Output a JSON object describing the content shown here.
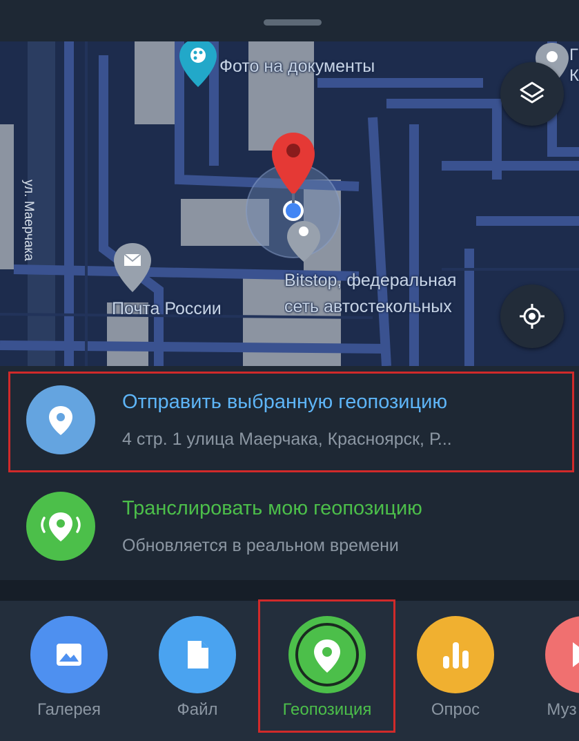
{
  "map": {
    "labels": {
      "photo_docs": "Фото на документы",
      "post_office": "Почта России",
      "bitstop_line1": "Bitstop, федеральная",
      "bitstop_line2": "сеть автостекольных",
      "street": "ул. Маерчака",
      "edge_label_top": "Г",
      "edge_label_bottom": "К"
    },
    "icons": [
      "palette-icon",
      "mail-icon",
      "layers-icon",
      "my-location-icon",
      "red-pin-icon",
      "current-location-icon"
    ]
  },
  "send_location": {
    "title": "Отправить выбранную геопозицию",
    "address": "4 стр. 1 улица Маерчака, Красноярск, Р...",
    "title_color": "#5eb5f7",
    "icon_color": "#64a4e0"
  },
  "live_location": {
    "title": "Транслировать мою геопозицию",
    "subtitle": "Обновляется в реальном времени",
    "title_color": "#4cbf4a",
    "icon_color": "#4cbf4a"
  },
  "attach_menu": {
    "items": [
      {
        "label": "Галерея",
        "icon": "gallery-icon",
        "color": "#4e90f0"
      },
      {
        "label": "Файл",
        "icon": "file-icon",
        "color": "#4aa3f0"
      },
      {
        "label": "Геопозиция",
        "icon": "location-icon",
        "color": "#4cbf4a",
        "selected": true
      },
      {
        "label": "Опрос",
        "icon": "poll-icon",
        "color": "#f0b030"
      },
      {
        "label": "Муз",
        "icon": "music-icon",
        "color": "#f07070"
      }
    ]
  }
}
